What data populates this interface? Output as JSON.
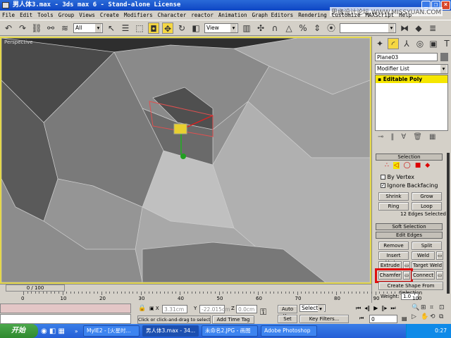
{
  "window": {
    "title": "男人体3.max - 3ds max 6 - Stand-alone License",
    "watermark": "思缘设计论坛 WWW.MISSYUAN.COM"
  },
  "menu": [
    "File",
    "Edit",
    "Tools",
    "Group",
    "Views",
    "Create",
    "Modifiers",
    "Character",
    "reactor",
    "Animation",
    "Graph Editors",
    "Rendering",
    "Customize",
    "MAXScript",
    "Help"
  ],
  "toolbar": {
    "selection_filter": "All",
    "ref_coord": "View",
    "named_selection": ""
  },
  "viewport": {
    "label": "Perspective"
  },
  "panel": {
    "object_name": "Plane03",
    "modifier_list": "Modifier List",
    "stack_item": "Editable Poly",
    "selection": {
      "title": "Selection",
      "by_vertex": "By Vertex",
      "by_vertex_checked": false,
      "ignore_backfacing": "Ignore Backfacing",
      "ignore_backfacing_checked": true,
      "shrink": "Shrink",
      "grow": "Grow",
      "ring": "Ring",
      "loop": "Loop",
      "status": "12 Edges Selected"
    },
    "soft_selection": "Soft Selection",
    "edit_edges": {
      "title": "Edit Edges",
      "remove": "Remove",
      "split": "Split",
      "insert_vertex": "Insert Vertex",
      "weld": "Weld",
      "extrude": "Extrude",
      "target_weld": "Target Weld",
      "chamfer": "Chamfer",
      "connect": "Connect",
      "create_shape": "Create Shape From Selection",
      "weight_label": "Weight:",
      "weight_value": "1.0"
    }
  },
  "timeline": {
    "frame": "0 / 100",
    "ticks": [
      "0",
      "10",
      "20",
      "30",
      "40",
      "50",
      "60",
      "70",
      "80",
      "90",
      "100"
    ]
  },
  "status": {
    "x": "3.31cm",
    "y": "-22.015cm",
    "z": "0.0cm",
    "prompt": "Click or click-and-drag to select obj",
    "add_time_tag": "Add Time Tag",
    "auto_key": "Auto Key",
    "set_key": "Set Key",
    "key_mode": "Selected",
    "key_filters": "Key Filters...",
    "current_frame": "0"
  },
  "taskbar": {
    "start": "开始",
    "tasks": [
      "MyIE2 - [火星时...",
      "男人体3.max - 34...",
      "未命名2.JPG - 画图",
      "Adobe Photoshop"
    ],
    "clock": "0:27"
  },
  "colors": {
    "highlight": "#e01010",
    "active_yellow": "#f5e600"
  }
}
